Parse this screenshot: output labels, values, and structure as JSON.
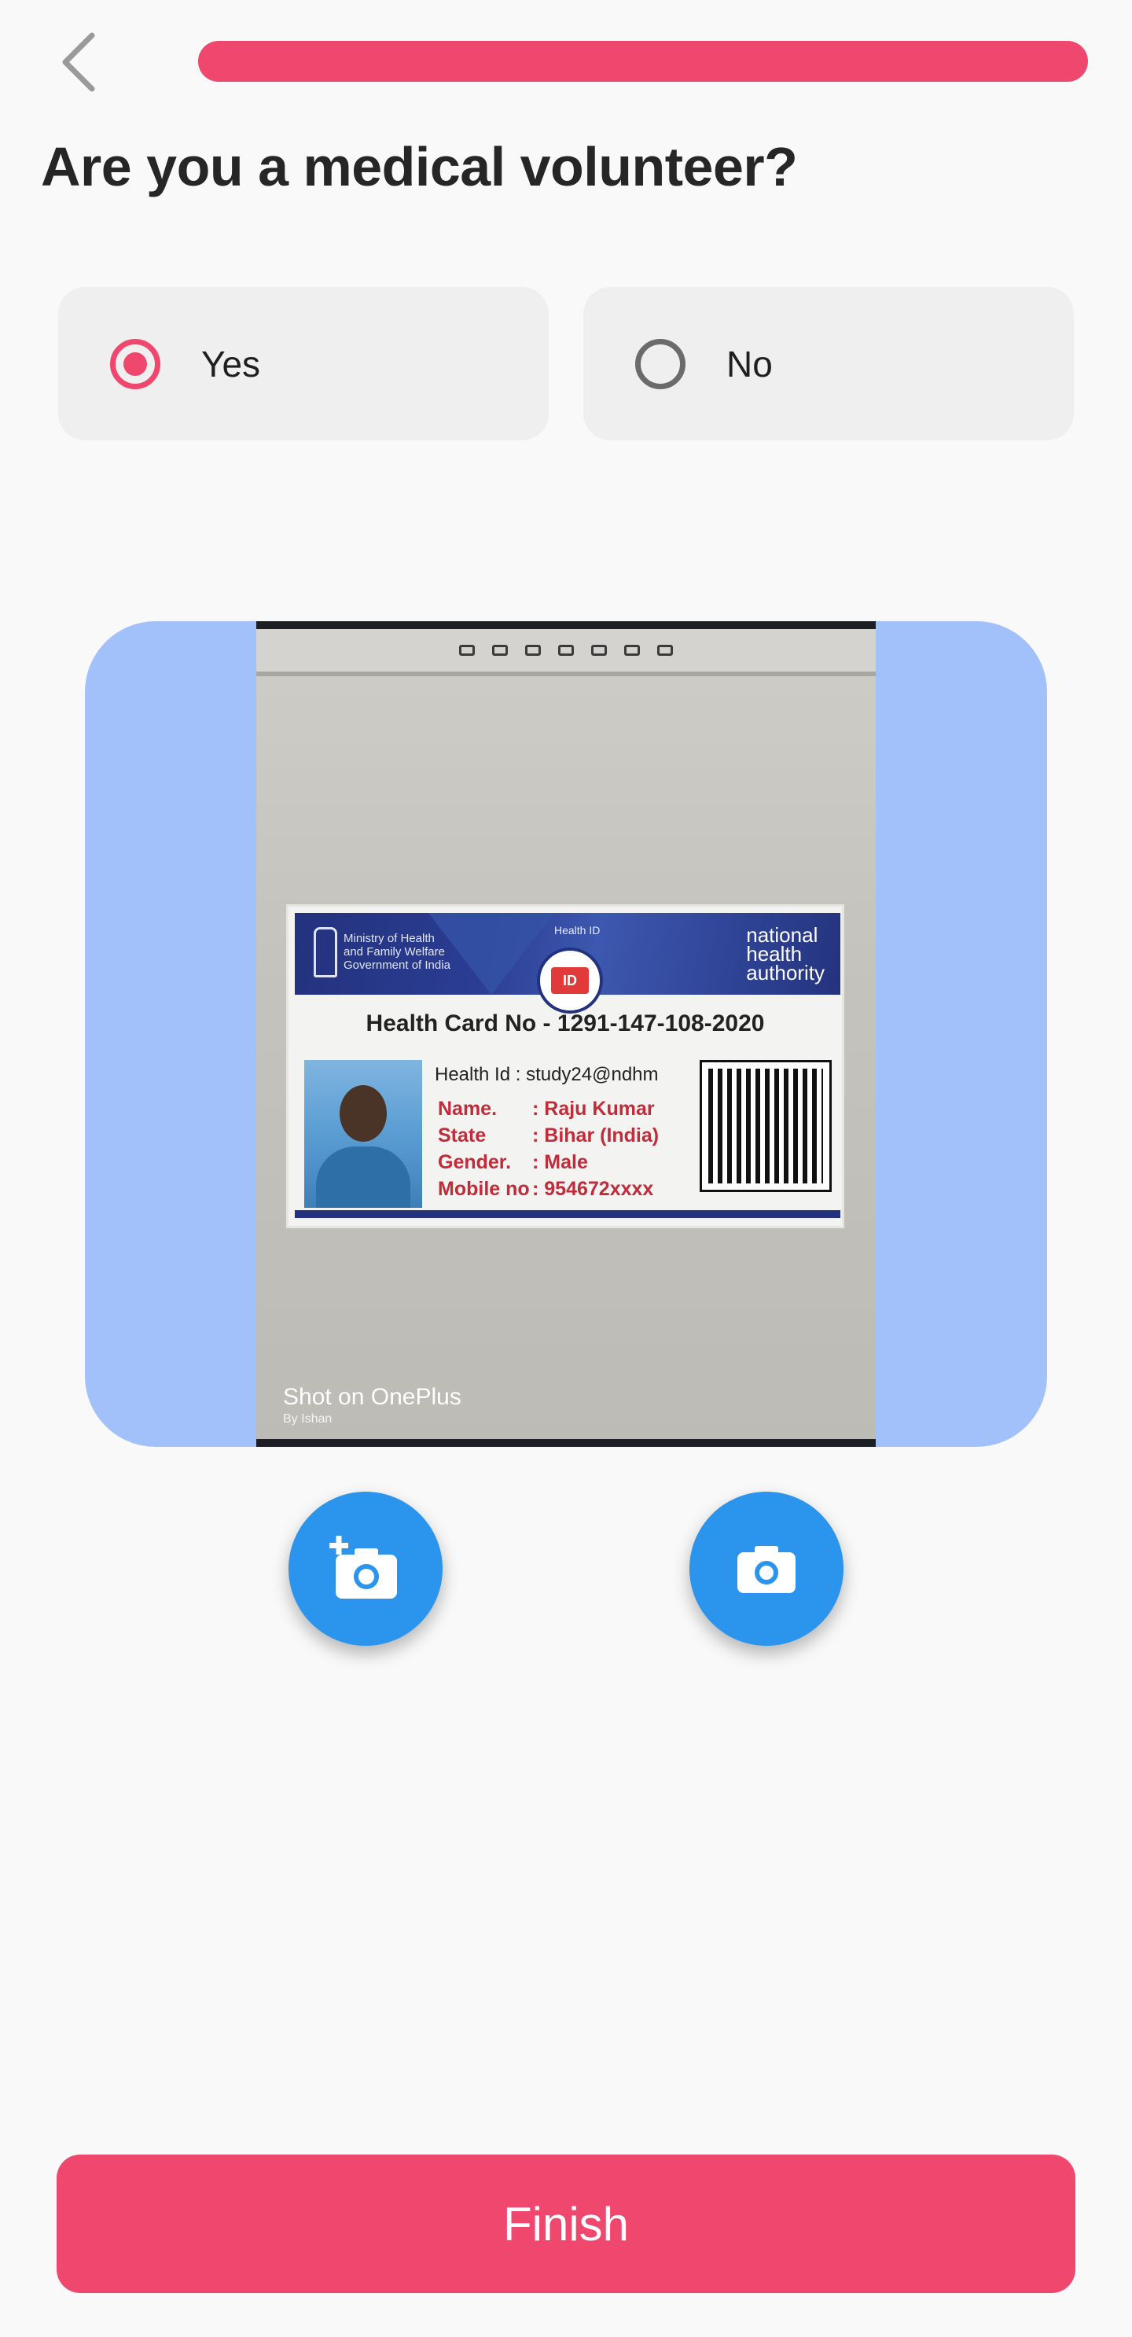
{
  "header": {
    "back_icon": "chevron-left-icon",
    "progress": 1.0,
    "progress_color": "#f0476f"
  },
  "question": {
    "title": "Are you a medical volunteer?"
  },
  "options": [
    {
      "label": "Yes",
      "selected": true
    },
    {
      "label": "No",
      "selected": false
    }
  ],
  "photo": {
    "watermark": "Shot on OnePlus",
    "watermark_sub": "By Ishan",
    "card": {
      "ministry": "Ministry of Health\nand Family Welfare\nGovernment of India",
      "header_label": "Health ID",
      "logo_text": "ID",
      "authority": "national\nhealth\nauthority",
      "card_number": "Health Card No - 1291-147-108-2020",
      "health_id": "Health Id : study24@ndhm",
      "fields": [
        {
          "k": "Name.",
          "v": ": Raju Kumar"
        },
        {
          "k": "State",
          "v": ": Bihar (India)"
        },
        {
          "k": "Gender.",
          "v": ": Male"
        },
        {
          "k": "Mobile no",
          "v": ": 954672xxxx"
        }
      ]
    }
  },
  "actions": {
    "add_photo_icon": "add-a-photo-icon",
    "camera_icon": "camera-icon"
  },
  "footer": {
    "finish_label": "Finish"
  },
  "colors": {
    "accent": "#f0476f",
    "fab": "#2b94ec",
    "photo_frame": "#a2c1fa"
  }
}
